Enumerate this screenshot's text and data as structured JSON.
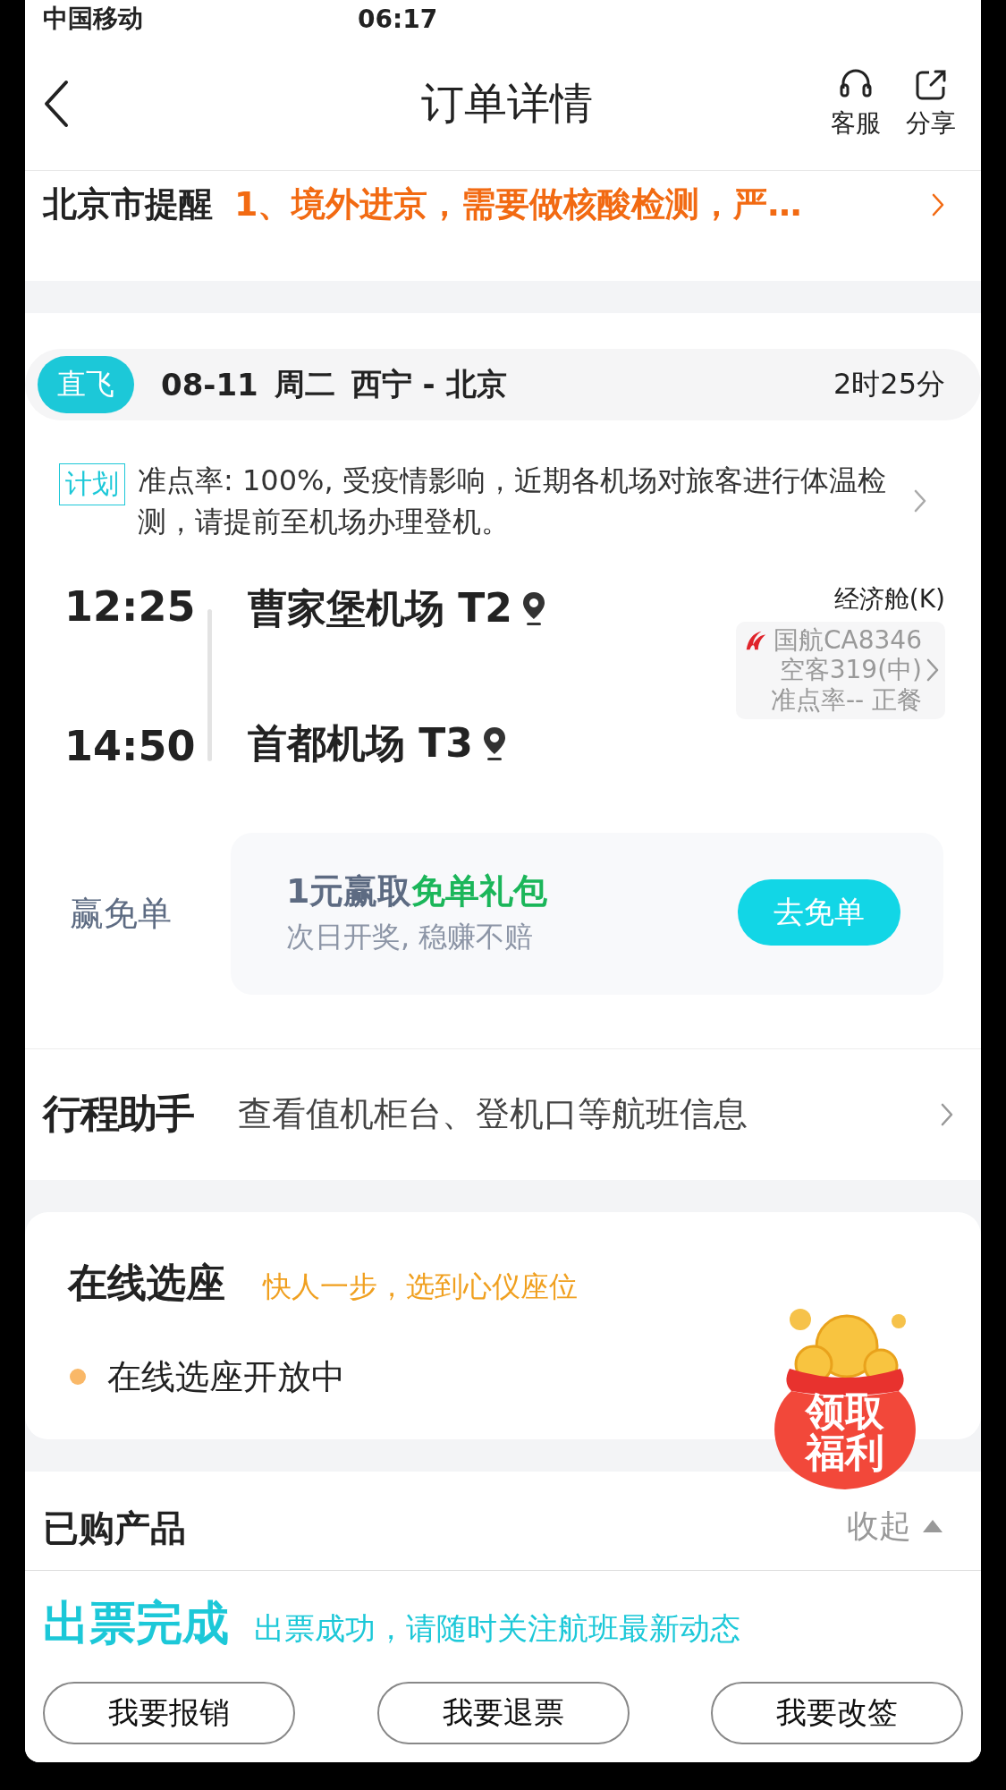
{
  "status_bar": {
    "carrier": "中国移动",
    "time": "06:17"
  },
  "nav": {
    "title": "订单详情",
    "actions": [
      {
        "label": "客服",
        "kind": "headset"
      },
      {
        "label": "分享",
        "kind": "share"
      }
    ]
  },
  "notice": {
    "label": "北京市提醒",
    "text": "1、境外进京，需要做核酸检测，严…"
  },
  "flight": {
    "tag": "直飞",
    "date": "08-11",
    "weekday": "周二",
    "route": "西宁 - 北京",
    "duration": "2时25分",
    "plan_tag": "计划",
    "note": "准点率: 100%, 受疫情影响，近期各机场对旅客进行体温检测，请提前至机场办理登机。",
    "departure": {
      "time": "12:25",
      "airport": "曹家堡机场 T2"
    },
    "arrival": {
      "time": "14:50",
      "airport": "首都机场 T3"
    },
    "cabin": "经济舱(K)",
    "airline": "国航CA8346",
    "aircraft": "空客319(中)",
    "punctuality": "准点率-- 正餐"
  },
  "promo": {
    "label": "赢免单",
    "title_prefix": "1元赢取",
    "title_highlight": "免单礼包",
    "subtitle": "次日开奖, 稳赚不赔",
    "button": "去免单"
  },
  "assistant": {
    "logo": "行程助手",
    "text": "查看值机柜台、登机口等航班信息"
  },
  "seat": {
    "title": "在线选座",
    "slogan": "快人一步，选到心仪座位",
    "status": "在线选座开放中"
  },
  "float_badge": {
    "label": "领取福利"
  },
  "products": {
    "title": "已购产品",
    "toggle": "收起",
    "expanded": true
  },
  "ticket_status": {
    "title": "出票完成",
    "message": "出票成功，请随时关注航班最新动态"
  },
  "buttons": [
    "我要报销",
    "我要退票",
    "我要改签"
  ]
}
